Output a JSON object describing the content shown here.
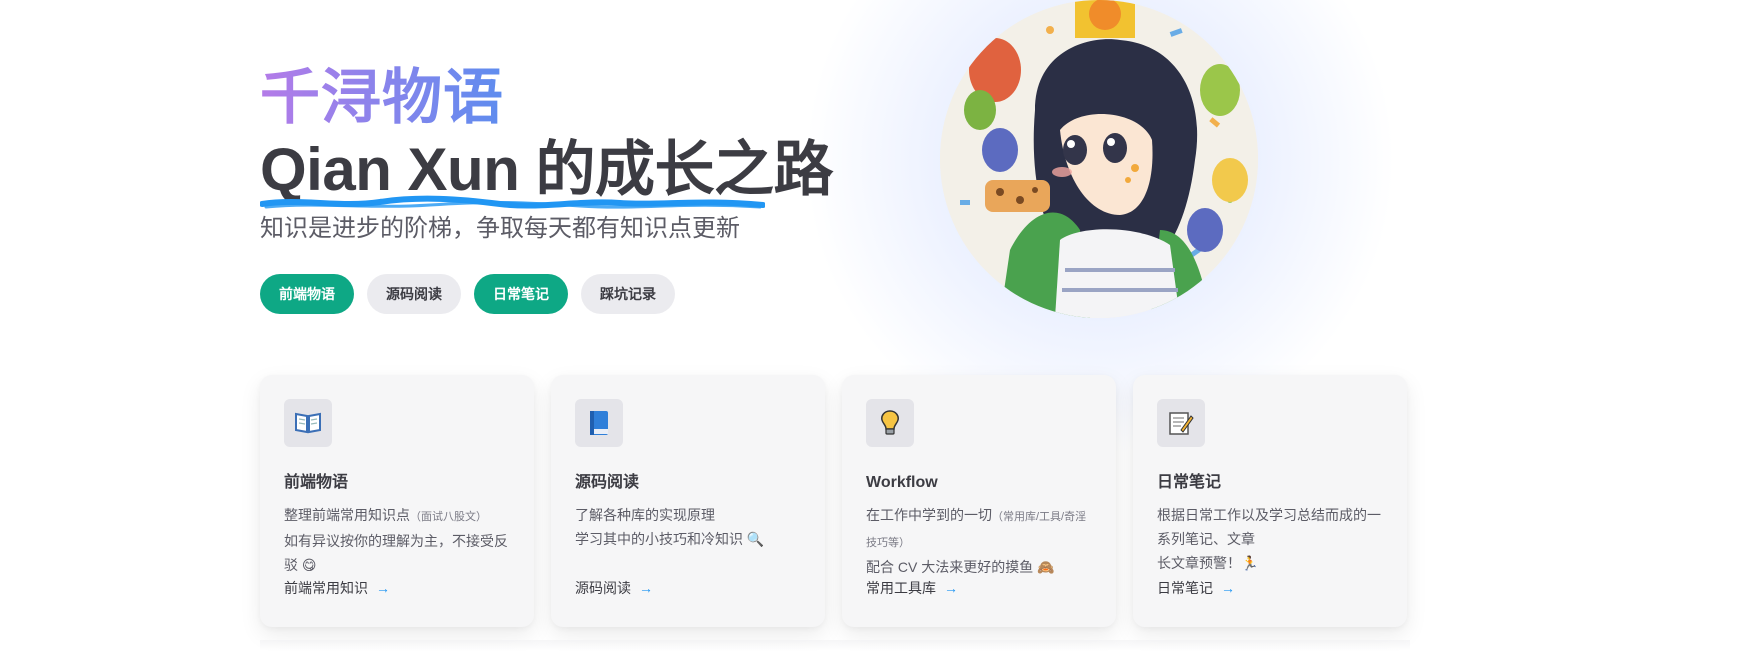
{
  "hero": {
    "name": "千浔物语",
    "title": "Qian Xun 的成长之路",
    "tagline": "知识是进步的阶梯，争取每天都有知识点更新",
    "actions": [
      {
        "label": "前端物语",
        "theme": "brand"
      },
      {
        "label": "源码阅读",
        "theme": "alt"
      },
      {
        "label": "日常笔记",
        "theme": "brand"
      },
      {
        "label": "踩坑记录",
        "theme": "alt"
      }
    ]
  },
  "colors": {
    "brand": "#0ea885",
    "accent": "#2196f3",
    "text": "#3c3c43"
  },
  "features": [
    {
      "icon": "open-book-icon",
      "title": "前端物语",
      "details_line1": "整理前端常用知识点",
      "details_line1_small": "（面试八股文）",
      "details_line2": "如有异议按你的理解为主，不接受反驳 😋",
      "link": "前端常用知识"
    },
    {
      "icon": "blue-book-icon",
      "title": "源码阅读",
      "details_line1": "了解各种库的实现原理",
      "details_line2": "学习其中的小技巧和冷知识 🔍",
      "link": "源码阅读"
    },
    {
      "icon": "light-bulb-icon",
      "title": "Workflow",
      "details_line1": "在工作中学到的一切",
      "details_line1_small": "（常用库/工具/奇淫技巧等）",
      "details_line2": "配合 CV 大法来更好的摸鱼 🙈",
      "link": "常用工具库"
    },
    {
      "icon": "memo-icon",
      "title": "日常笔记",
      "details_line1": "根据日常工作以及学习总结而成的一系列笔记、文章",
      "details_line2": "长文章预警！🏃",
      "link": "日常笔记"
    }
  ]
}
